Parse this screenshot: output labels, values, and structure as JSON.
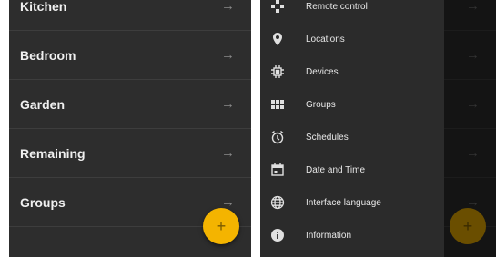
{
  "left_screen": {
    "rooms": [
      {
        "label": "Kitchen",
        "arrow": "→"
      },
      {
        "label": "Bedroom",
        "arrow": "→"
      },
      {
        "label": "Garden",
        "arrow": "→"
      },
      {
        "label": "Remaining",
        "arrow": "→"
      },
      {
        "label": "Groups",
        "arrow": "→"
      }
    ],
    "fab_symbol": "+",
    "colors": {
      "background": "#2d2d2d",
      "fab": "#f4b400"
    }
  },
  "right_screen": {
    "menu": [
      {
        "label": "Remote control",
        "icon": "gamepad-icon"
      },
      {
        "label": "Locations",
        "icon": "location-pin-icon"
      },
      {
        "label": "Devices",
        "icon": "chip-icon"
      },
      {
        "label": "Groups",
        "icon": "grid-icon"
      },
      {
        "label": "Schedules",
        "icon": "alarm-clock-icon"
      },
      {
        "label": "Date and Time",
        "icon": "calendar-icon"
      },
      {
        "label": "Interface language",
        "icon": "globe-icon"
      },
      {
        "label": "Information",
        "icon": "info-icon"
      }
    ],
    "arrow": "→",
    "fab_symbol": "+"
  }
}
